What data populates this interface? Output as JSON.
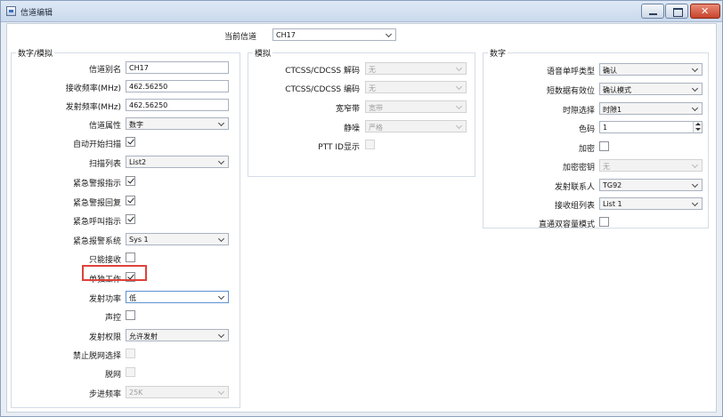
{
  "window": {
    "title": "信道编辑"
  },
  "header": {
    "current_channel_label": "当前信道",
    "current_channel_value": "CH17"
  },
  "digital_analog": {
    "title": "数字/模拟",
    "alias_label": "信道别名",
    "alias_value": "CH17",
    "rx_freq_label": "接收频率(MHz)",
    "rx_freq_value": "462.56250",
    "tx_freq_label": "发射频率(MHz)",
    "tx_freq_value": "462.56250",
    "attr_label": "信道属性",
    "attr_value": "数字",
    "auto_scan_label": "自动开始扫描",
    "auto_scan_checked": true,
    "scan_list_label": "扫描列表",
    "scan_list_value": "List2",
    "emerg_ind_label": "紧急警报指示",
    "emerg_ind_checked": true,
    "emerg_reply_label": "紧急警报回复",
    "emerg_reply_checked": true,
    "emerg_call_label": "紧急呼叫指示",
    "emerg_call_checked": true,
    "emerg_sys_label": "紧急报警系统",
    "emerg_sys_value": "Sys 1",
    "rx_only_label": "只能接收",
    "rx_only_checked": false,
    "talkaround_label": "单独工作",
    "talkaround_checked": true,
    "tx_power_label": "发射功率",
    "tx_power_value": "低",
    "vox_label": "声控",
    "vox_checked": false,
    "tx_permit_label": "发射权限",
    "tx_permit_value": "允许发射",
    "offnet_sel_label": "禁止脱网选择",
    "offnet_sel_checked": false,
    "offnet_label": "脱网",
    "offnet_checked": false,
    "step_label": "步进频率",
    "step_value": "25K"
  },
  "analog": {
    "title": "模拟",
    "ctcss_dec_label": "CTCSS/CDCSS 解码",
    "ctcss_dec_value": "无",
    "ctcss_enc_label": "CTCSS/CDCSS 编码",
    "ctcss_enc_value": "无",
    "bandwidth_label": "宽窄带",
    "bandwidth_value": "宽带",
    "squelch_label": "静噪",
    "squelch_value": "严格",
    "ptt_id_label": "PTT ID显示",
    "ptt_id_checked": false
  },
  "digital": {
    "title": "数字",
    "voice_call_label": "语音单呼类型",
    "voice_call_value": "确认",
    "sms_label": "短数据有效位",
    "sms_value": "确认模式",
    "slot_label": "时隙选择",
    "slot_value": "时隙1",
    "color_code_label": "色码",
    "color_code_value": "1",
    "encrypt_label": "加密",
    "encrypt_checked": false,
    "encrypt_key_label": "加密密钥",
    "encrypt_key_value": "无",
    "tx_contact_label": "发射联系人",
    "tx_contact_value": "TG92",
    "rx_group_label": "接收组列表",
    "rx_group_value": "List 1",
    "dual_capacity_label": "直通双容量模式",
    "dual_capacity_checked": false
  }
}
